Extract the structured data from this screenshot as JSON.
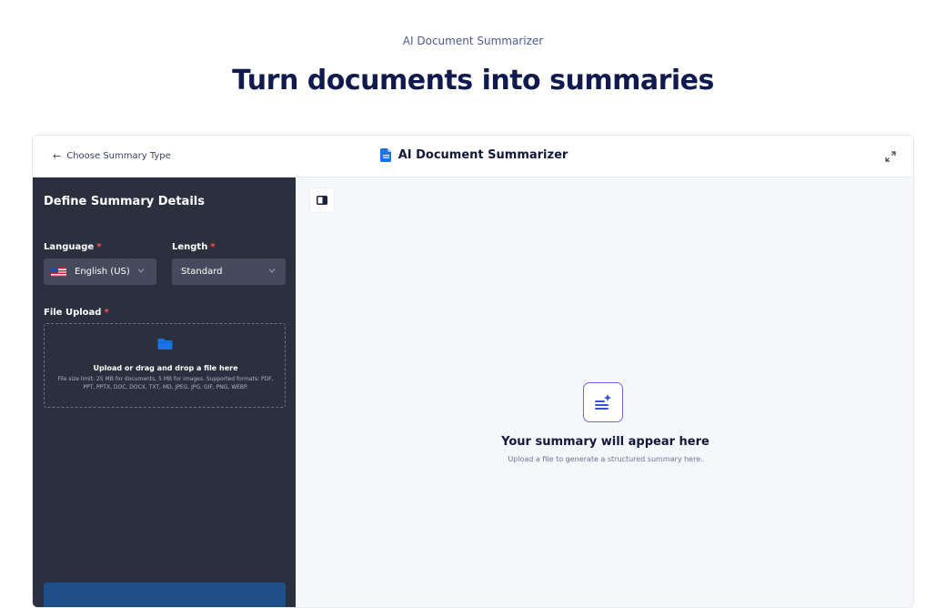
{
  "page": {
    "eyebrow": "AI Document Summarizer",
    "headline": "Turn documents into summaries"
  },
  "topbar": {
    "back_label": "Choose Summary Type",
    "title": "AI Document Summarizer",
    "icons": {
      "back": "arrow-left-icon",
      "doc": "document-icon",
      "expand": "expand-icon"
    }
  },
  "sidebar": {
    "title": "Define Summary Details",
    "language_label": "Language",
    "language_value": "English (US)",
    "length_label": "Length",
    "length_value": "Standard",
    "required_mark": "*",
    "file_upload_label": "File Upload",
    "dropzone_title": "Upload or drag and drop a file here",
    "dropzone_help": "File size limit: 25 MB for documents, 5 MB for images. Supported formats: PDF, PPT, PPTX, DOC, DOCX, TXT, MD, JPEG, JPG, GIF, PNG, WEBP."
  },
  "main": {
    "empty_title": "Your summary will appear here",
    "empty_subtitle": "Upload a file to generate a structured summary here."
  },
  "colors": {
    "brand_dark": "#101a4f",
    "sidebar_bg": "#2b303f",
    "accent_blue": "#1a73e8",
    "accent_purple": "#7b5cf0",
    "required_red": "#ff4d4d"
  }
}
